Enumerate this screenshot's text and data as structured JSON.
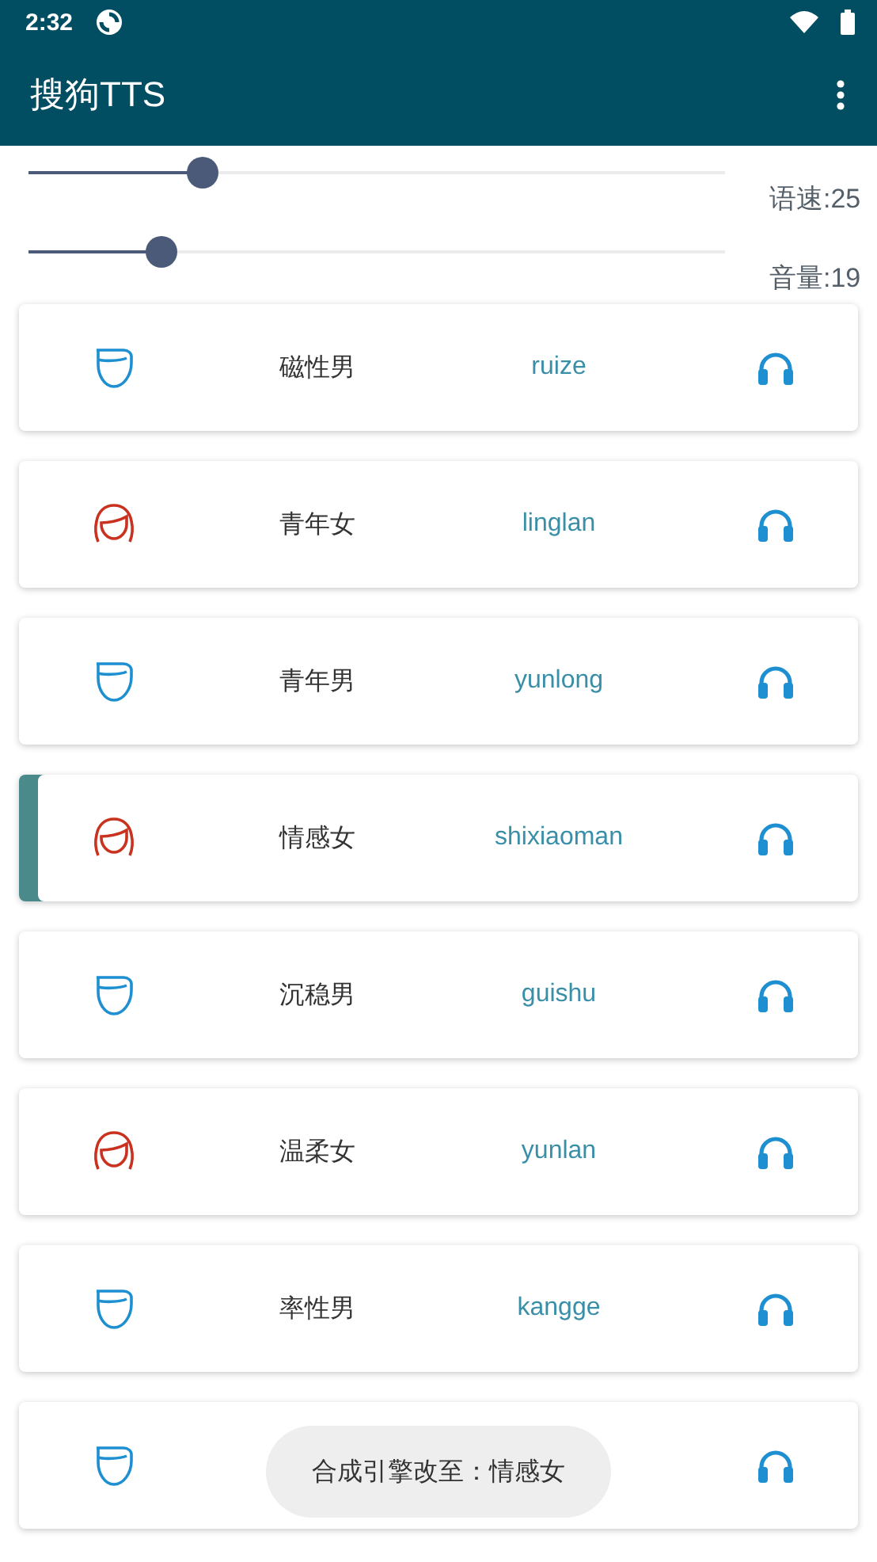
{
  "status_bar": {
    "time": "2:32"
  },
  "app_bar": {
    "title": "搜狗TTS"
  },
  "sliders": [
    {
      "label": "语速:25",
      "level": 0.25
    },
    {
      "label": "音量:19",
      "level": 0.19
    }
  ],
  "voices": [
    {
      "kind": "male",
      "name": "磁性男",
      "id": "ruize",
      "selected": false
    },
    {
      "kind": "female",
      "name": "青年女",
      "id": "linglan",
      "selected": false
    },
    {
      "kind": "male",
      "name": "青年男",
      "id": "yunlong",
      "selected": false
    },
    {
      "kind": "female",
      "name": "情感女",
      "id": "shixiaoman",
      "selected": true
    },
    {
      "kind": "male",
      "name": "沉稳男",
      "id": "guishu",
      "selected": false
    },
    {
      "kind": "female",
      "name": "温柔女",
      "id": "yunlan",
      "selected": false
    },
    {
      "kind": "male",
      "name": "率性男",
      "id": "kangge",
      "selected": false
    },
    {
      "kind": "male",
      "selected": false
    }
  ],
  "toast": {
    "text": "合成引擎改至：情感女"
  }
}
